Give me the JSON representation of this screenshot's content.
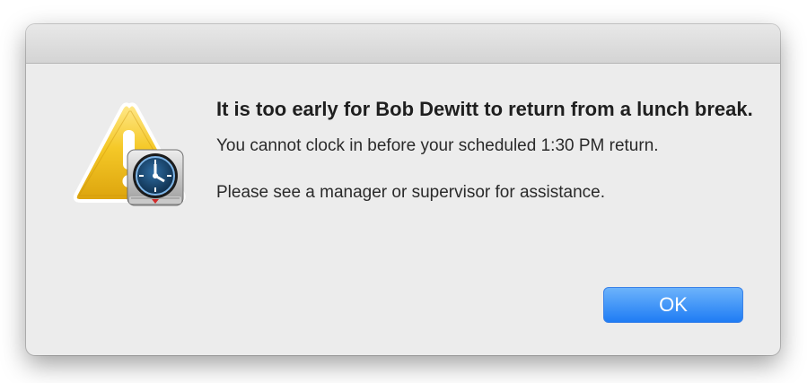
{
  "dialog": {
    "headline": "It is too early for Bob Dewitt to return from a lunch break.",
    "detail": "You cannot clock in before your scheduled 1:30 PM return.",
    "assistance": "Please see a manager or supervisor for assistance.",
    "ok_label": "OK",
    "icons": {
      "warning": "warning-triangle-icon",
      "badge": "time-clock-icon"
    }
  },
  "colors": {
    "button_accent": "#1f7cf4",
    "warning_yellow": "#f2c31f"
  }
}
